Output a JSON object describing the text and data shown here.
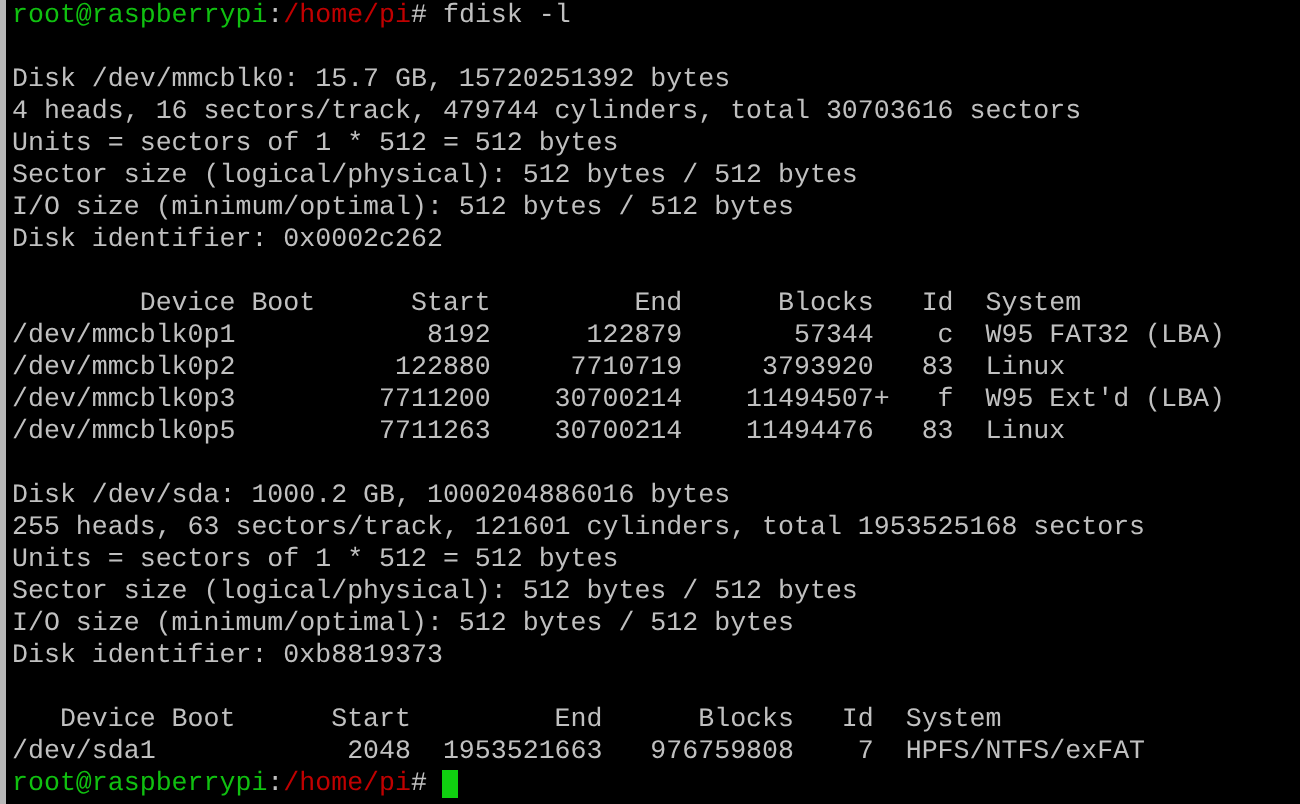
{
  "terminal": {
    "lines": [
      {
        "kind": "prompt",
        "user": "root@raspberrypi",
        "separator": ":",
        "path": "/home/pi",
        "symbol": "#",
        "command": "fdisk -l",
        "cursor": false
      },
      {
        "kind": "blank"
      },
      {
        "kind": "text",
        "text": "Disk /dev/mmcblk0: 15.7 GB, 15720251392 bytes"
      },
      {
        "kind": "text",
        "text": "4 heads, 16 sectors/track, 479744 cylinders, total 30703616 sectors"
      },
      {
        "kind": "text",
        "text": "Units = sectors of 1 * 512 = 512 bytes"
      },
      {
        "kind": "text",
        "text": "Sector size (logical/physical): 512 bytes / 512 bytes"
      },
      {
        "kind": "text",
        "text": "I/O size (minimum/optimal): 512 bytes / 512 bytes"
      },
      {
        "kind": "text",
        "text": "Disk identifier: 0x0002c262"
      },
      {
        "kind": "blank"
      },
      {
        "kind": "text",
        "text": "        Device Boot      Start         End      Blocks   Id  System"
      },
      {
        "kind": "text",
        "text": "/dev/mmcblk0p1            8192      122879       57344    c  W95 FAT32 (LBA)"
      },
      {
        "kind": "text",
        "text": "/dev/mmcblk0p2          122880     7710719     3793920   83  Linux"
      },
      {
        "kind": "text",
        "text": "/dev/mmcblk0p3         7711200    30700214    11494507+   f  W95 Ext'd (LBA)"
      },
      {
        "kind": "text",
        "text": "/dev/mmcblk0p5         7711263    30700214    11494476   83  Linux"
      },
      {
        "kind": "blank"
      },
      {
        "kind": "text",
        "text": "Disk /dev/sda: 1000.2 GB, 1000204886016 bytes"
      },
      {
        "kind": "text",
        "text": "255 heads, 63 sectors/track, 121601 cylinders, total 1953525168 sectors"
      },
      {
        "kind": "text",
        "text": "Units = sectors of 1 * 512 = 512 bytes"
      },
      {
        "kind": "text",
        "text": "Sector size (logical/physical): 512 bytes / 512 bytes"
      },
      {
        "kind": "text",
        "text": "I/O size (minimum/optimal): 512 bytes / 512 bytes"
      },
      {
        "kind": "text",
        "text": "Disk identifier: 0xb8819373"
      },
      {
        "kind": "blank"
      },
      {
        "kind": "text",
        "text": "   Device Boot      Start         End      Blocks   Id  System"
      },
      {
        "kind": "text",
        "text": "/dev/sda1            2048  1953521663   976759808    7  HPFS/NTFS/exFAT"
      },
      {
        "kind": "prompt",
        "user": "root@raspberrypi",
        "separator": ":",
        "path": "/home/pi",
        "symbol": "#",
        "cursor": true
      }
    ]
  }
}
